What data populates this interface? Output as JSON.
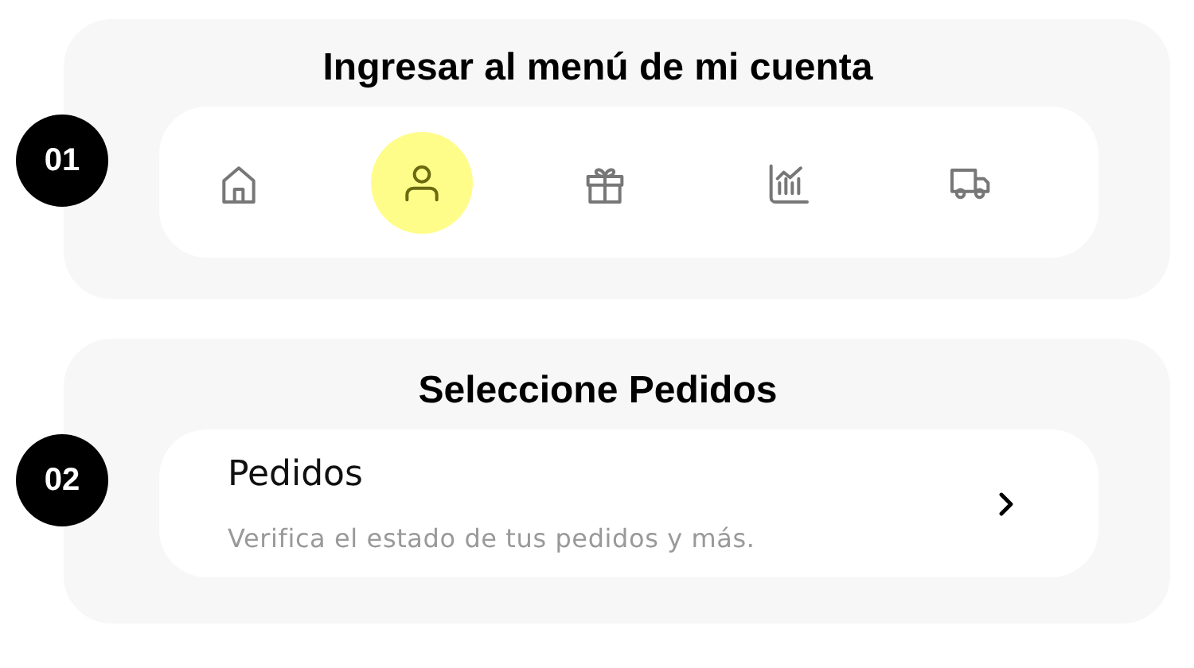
{
  "steps": [
    {
      "number": "01",
      "title": "Ingresar al menú de mi cuenta",
      "kind": "nav",
      "nav": [
        {
          "kind": "home",
          "selected": false
        },
        {
          "kind": "user",
          "selected": true
        },
        {
          "kind": "gift",
          "selected": false
        },
        {
          "kind": "chart",
          "selected": false
        },
        {
          "kind": "truck",
          "selected": false
        }
      ]
    },
    {
      "number": "02",
      "title": "Seleccione Pedidos",
      "kind": "menu",
      "menu_item": {
        "label": "Pedidos",
        "description": "Verifica el estado de tus pedidos y más."
      }
    }
  ]
}
